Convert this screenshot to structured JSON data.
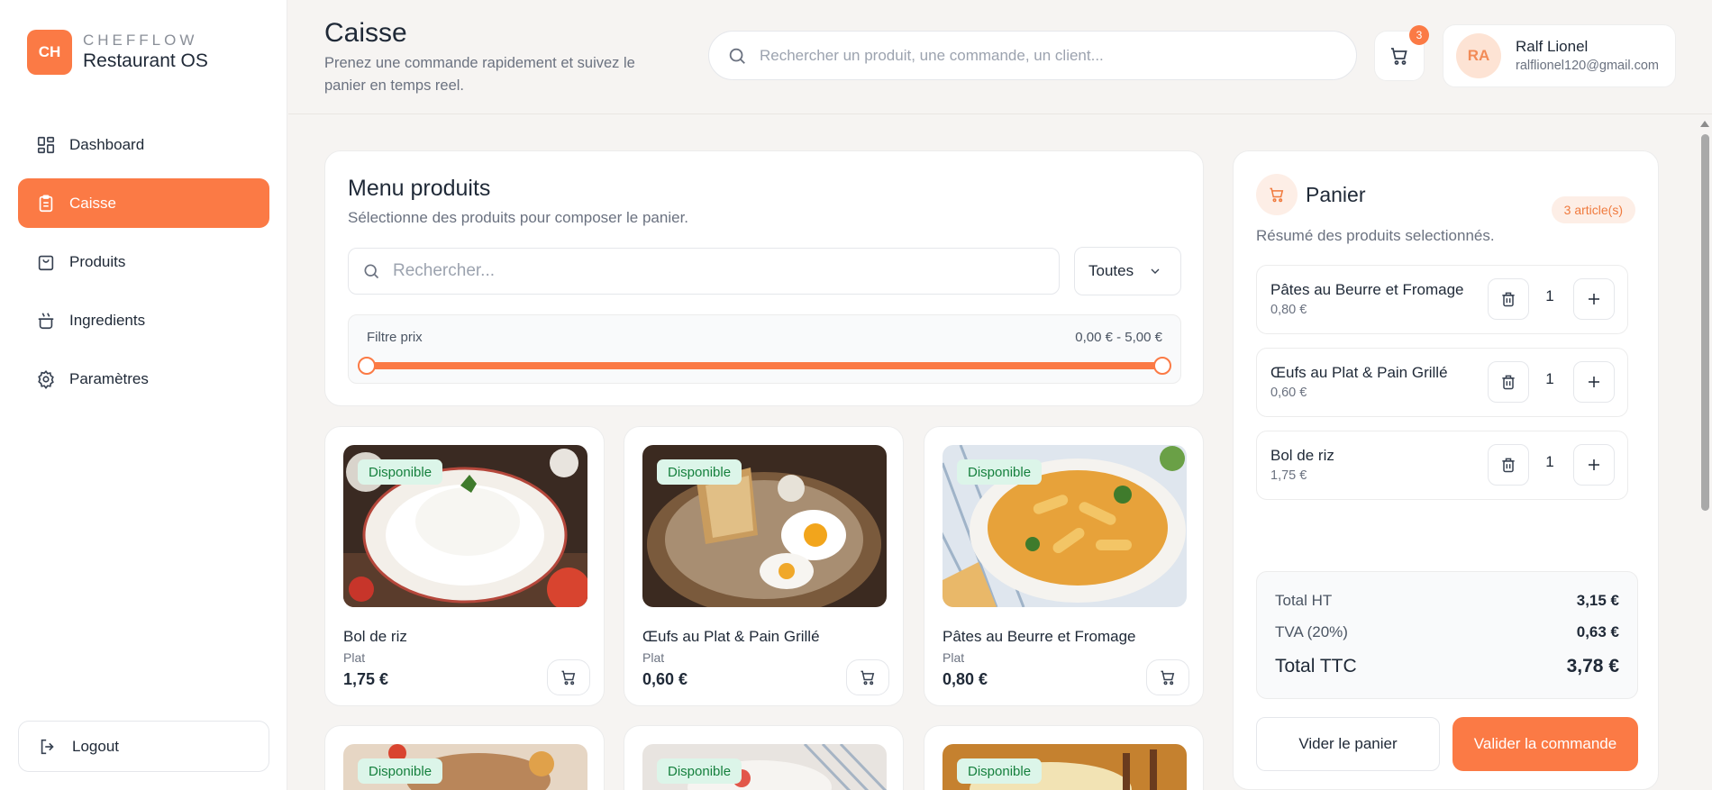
{
  "brand": {
    "initials": "CH",
    "eyebrow": "CHEFFLOW",
    "name": "Restaurant OS"
  },
  "nav": [
    {
      "label": "Dashboard",
      "icon": "dashboard-icon",
      "active": false
    },
    {
      "label": "Caisse",
      "icon": "clipboard-icon",
      "active": true
    },
    {
      "label": "Produits",
      "icon": "bag-icon",
      "active": false
    },
    {
      "label": "Ingredients",
      "icon": "pot-icon",
      "active": false
    },
    {
      "label": "Paramètres",
      "icon": "gear-icon",
      "active": false
    }
  ],
  "logout_label": "Logout",
  "header": {
    "title": "Caisse",
    "subtitle": "Prenez une commande rapidement et suivez le panier en temps reel.",
    "search_placeholder": "Rechercher un produit, une commande, un client...",
    "cart_count": "3",
    "user": {
      "initials": "RA",
      "name": "Ralf Lionel",
      "email": "ralflionel120@gmail.com"
    }
  },
  "menu": {
    "title": "Menu produits",
    "subtitle": "Sélectionne des produits pour composer le panier.",
    "search_placeholder": "Rechercher...",
    "category": "Toutes",
    "price_filter": {
      "label": "Filtre prix",
      "range_text": "0,00 € - 5,00 €",
      "min": 0,
      "max": 5,
      "low": 0,
      "high": 5
    }
  },
  "products": [
    {
      "badge": "Disponible",
      "name": "Bol de riz",
      "category": "Plat",
      "price": "1,75 €",
      "image": "rice-bowl"
    },
    {
      "badge": "Disponible",
      "name": "Œufs au Plat & Pain Grillé",
      "category": "Plat",
      "price": "0,60 €",
      "image": "eggs-toast"
    },
    {
      "badge": "Disponible",
      "name": "Pâtes au Beurre et Fromage",
      "category": "Plat",
      "price": "0,80 €",
      "image": "pasta"
    },
    {
      "badge": "Disponible"
    },
    {
      "badge": "Disponible"
    },
    {
      "badge": "Disponible"
    }
  ],
  "cart": {
    "title": "Panier",
    "articles": "3 article(s)",
    "subtitle": "Résumé des produits selectionnés.",
    "items": [
      {
        "name": "Pâtes au Beurre et Fromage",
        "price": "0,80 €",
        "qty": "1"
      },
      {
        "name": "Œufs au Plat & Pain Grillé",
        "price": "0,60 €",
        "qty": "1"
      },
      {
        "name": "Bol de riz",
        "price": "1,75 €",
        "qty": "1"
      }
    ],
    "totals": {
      "ht_label": "Total HT",
      "ht_value": "3,15 €",
      "tva_label": "TVA (20%)",
      "tva_value": "0,63 €",
      "ttc_label": "Total TTC",
      "ttc_value": "3,78 €"
    },
    "clear_label": "Vider le panier",
    "validate_label": "Valider la commande"
  },
  "colors": {
    "accent": "#fb7a45",
    "badge_bg": "#dcf5e9",
    "badge_text": "#15803d"
  }
}
